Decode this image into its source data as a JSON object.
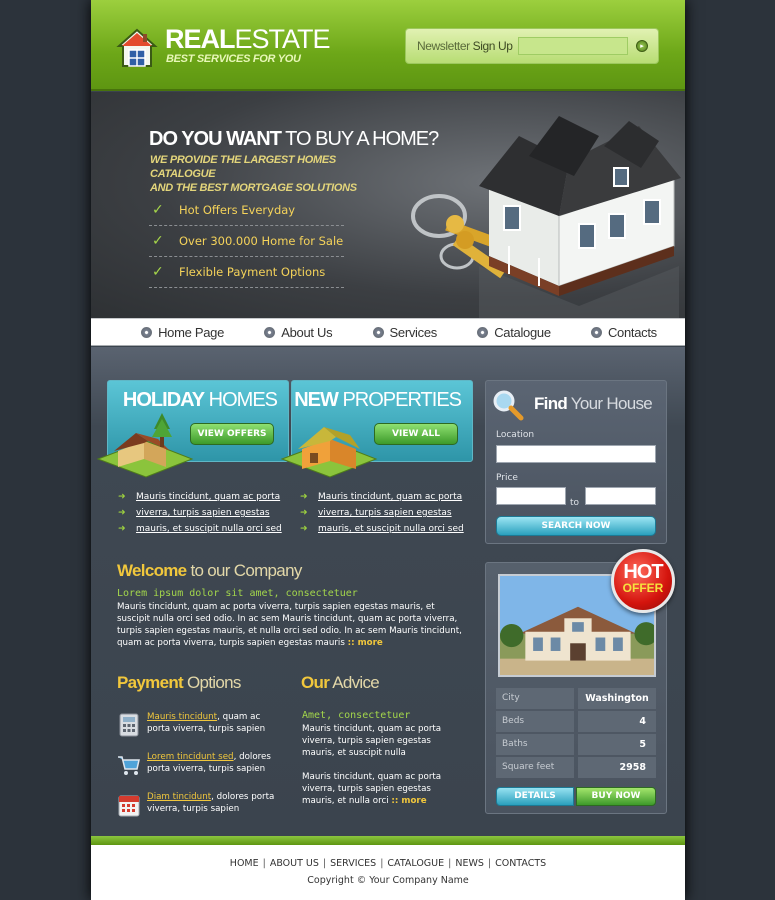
{
  "header": {
    "logo_bold": "REAL",
    "logo_light": "ESTATE",
    "logo_tagline": "BEST SERVICES FOR YOU",
    "newsletter_label": "Newsletter",
    "newsletter_label_bold": "Sign Up",
    "newsletter_value": ""
  },
  "banner": {
    "title_bold": "DO YOU WANT",
    "title_light": "TO BUY A HOME?",
    "subtitle_line1": "WE PROVIDE THE LARGEST HOMES CATALOGUE",
    "subtitle_line2": "AND THE BEST MORTGAGE SOLUTIONS",
    "features": [
      "Hot Offers Everyday",
      "Over 300.000 Home for Sale",
      "Flexible Payment Options"
    ]
  },
  "nav": {
    "items": [
      "Home Page",
      "About Us",
      "Services",
      "Catalogue",
      "Contacts"
    ]
  },
  "promos": [
    {
      "title_bold": "HOLIDAY",
      "title_light": "HOMES",
      "button": "VIEW OFFERS",
      "links": [
        "Mauris tincidunt, quam ac porta",
        "viverra, turpis sapien egestas",
        "mauris, et suscipit nulla orci sed"
      ]
    },
    {
      "title_bold": "NEW",
      "title_light": "PROPERTIES",
      "button": "VIEW ALL",
      "links": [
        "Mauris tincidunt, quam ac porta",
        "viverra, turpis sapien egestas",
        "mauris, et suscipit nulla orci sed"
      ]
    }
  ],
  "find": {
    "title_bold": "Find",
    "title_light": "Your House",
    "location_label": "Location",
    "location_value": "",
    "price_label": "Price",
    "price_from": "",
    "price_to": "",
    "to_label": "to",
    "search_button": "SEARCH NOW"
  },
  "welcome": {
    "title_bold": "Welcome",
    "title_light": "to our Company",
    "lead": "Lorem ipsum dolor sit amet, consectetuer",
    "body": "Mauris tincidunt, quam ac porta viverra, turpis sapien egestas mauris, et suscipit nulla orci sed odio. In ac sem Mauris tincidunt, quam ac porta viverra, turpis sapien egestas mauris, et nulla orci sed odio. In ac sem Mauris tincidunt, quam ac porta viverra, turpis sapien egestas mauris",
    "more": ":: more"
  },
  "payment": {
    "title_bold": "Payment",
    "title_light": "Options",
    "items": [
      {
        "icon": "calculator-icon",
        "link": "Mauris tincidunt",
        "text": ", quam ac porta viverra, turpis sapien"
      },
      {
        "icon": "cart-icon",
        "link": "Lorem tincidunt sed",
        "text": ", dolores porta viverra, turpis sapien"
      },
      {
        "icon": "calendar-icon",
        "link": "Diam tincidunt",
        "text": ", dolores porta viverra, turpis sapien"
      }
    ]
  },
  "advice": {
    "title_bold": "Our",
    "title_light": "Advice",
    "lead": "Amet, consectetuer",
    "para1": "Mauris tincidunt, quam ac porta viverra, turpis sapien egestas mauris, et suscipit nulla",
    "para2": "Mauris tincidunt, quam ac porta viverra, turpis sapien egestas mauris, et nulla orci",
    "more": ":: more"
  },
  "hot_offer": {
    "badge_line1": "HOT",
    "badge_line2": "OFFER",
    "props": [
      {
        "key": "City",
        "value": "Washington"
      },
      {
        "key": "Beds",
        "value": "4"
      },
      {
        "key": "Baths",
        "value": "5"
      },
      {
        "key": "Square feet",
        "value": "2958"
      }
    ],
    "details_button": "DETAILS",
    "buy_button": "BUY NOW"
  },
  "footer": {
    "links": [
      "HOME",
      "ABOUT US",
      "SERVICES",
      "CATALOGUE",
      "NEWS",
      "CONTACTS"
    ],
    "copyright": "Copyright © Your Company Name"
  },
  "colors": {
    "header_green": "#6da718",
    "accent_yellow": "#f1c73c",
    "accent_lime": "#a3d64b",
    "teal": "#2e95a8",
    "page_bg": "#2c333b"
  }
}
